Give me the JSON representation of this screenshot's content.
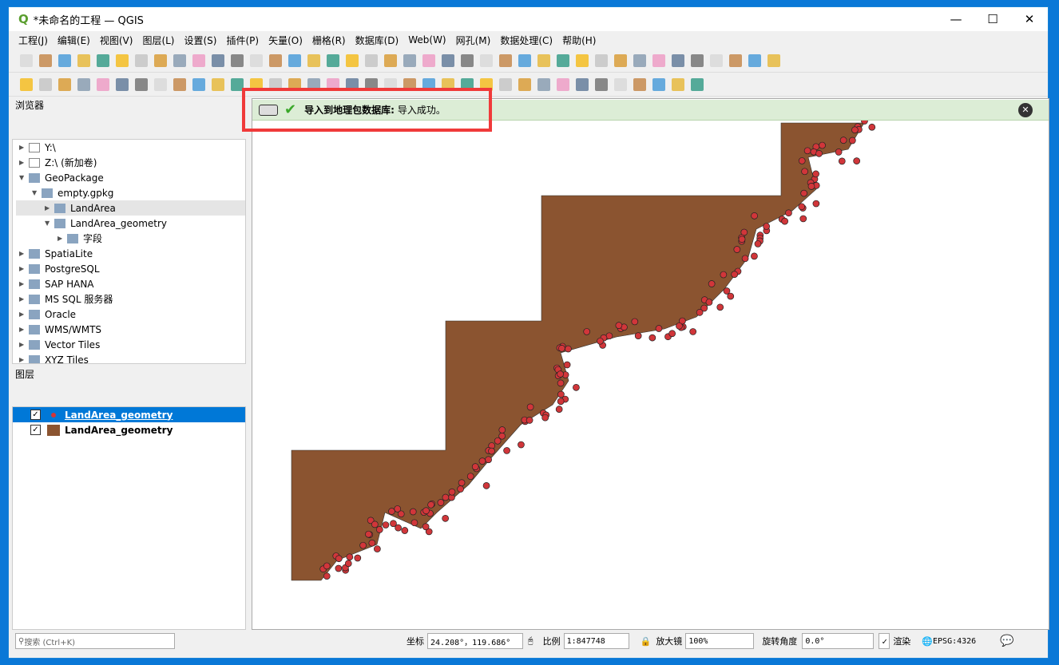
{
  "window": {
    "title": "*未命名的工程 — QGIS"
  },
  "menu": [
    "工程(J)",
    "编辑(E)",
    "视图(V)",
    "图层(L)",
    "设置(S)",
    "插件(P)",
    "矢量(O)",
    "栅格(R)",
    "数据库(D)",
    "Web(W)",
    "网孔(M)",
    "数据处理(C)",
    "帮助(H)"
  ],
  "browser": {
    "title": "浏览器",
    "items": [
      {
        "label": "Y:\\",
        "indent": 0,
        "icon": "folder-icon"
      },
      {
        "label": "Z:\\ (新加卷)",
        "indent": 0,
        "icon": "folder-icon"
      },
      {
        "label": "GeoPackage",
        "indent": 0,
        "icon": "geopackage-icon"
      },
      {
        "label": "empty.gpkg",
        "indent": 1,
        "icon": "database-icon"
      },
      {
        "label": "LandArea",
        "indent": 2,
        "icon": "polygon-layer-icon"
      },
      {
        "label": "LandArea_geometry",
        "indent": 2,
        "icon": "polygon-layer-icon"
      },
      {
        "label": "字段",
        "indent": 3,
        "icon": "fields-icon"
      },
      {
        "label": "SpatiaLite",
        "indent": 0,
        "icon": "spatialite-icon"
      },
      {
        "label": "PostgreSQL",
        "indent": 0,
        "icon": "postgresql-icon"
      },
      {
        "label": "SAP HANA",
        "indent": 0,
        "icon": "sap-hana-icon"
      },
      {
        "label": "MS SQL 服务器",
        "indent": 0,
        "icon": "mssql-icon"
      },
      {
        "label": "Oracle",
        "indent": 0,
        "icon": "oracle-icon"
      },
      {
        "label": "WMS/WMTS",
        "indent": 0,
        "icon": "globe-icon"
      },
      {
        "label": "Vector Tiles",
        "indent": 0,
        "icon": "grid-icon"
      },
      {
        "label": "XYZ Tiles",
        "indent": 0,
        "icon": "grid-icon"
      }
    ]
  },
  "layers": {
    "title": "图层",
    "items": [
      {
        "label": "LandArea_geometry",
        "checked": true,
        "symbol": "point",
        "color": "#d1363a",
        "selected": true
      },
      {
        "label": "LandArea_geometry",
        "checked": true,
        "symbol": "polygon",
        "color": "#8b5430",
        "selected": false
      }
    ]
  },
  "message": {
    "title": "导入到地理包数据库:",
    "text": "导入成功。"
  },
  "colors": {
    "land": "#8b5430",
    "points": "#d1363a",
    "highlight": "#f03a3a"
  },
  "status": {
    "search_placeholder": "搜索 (Ctrl+K)",
    "coord_label": "坐标",
    "coord": "24.208°，119.686°",
    "scale_label": "比例",
    "scale": "1:847748",
    "magnifier_label": "放大镜",
    "magnifier": "100%",
    "rotation_label": "旋转角度",
    "rotation": "0.0°",
    "render_label": "渲染",
    "crs": "EPSG:4326"
  }
}
